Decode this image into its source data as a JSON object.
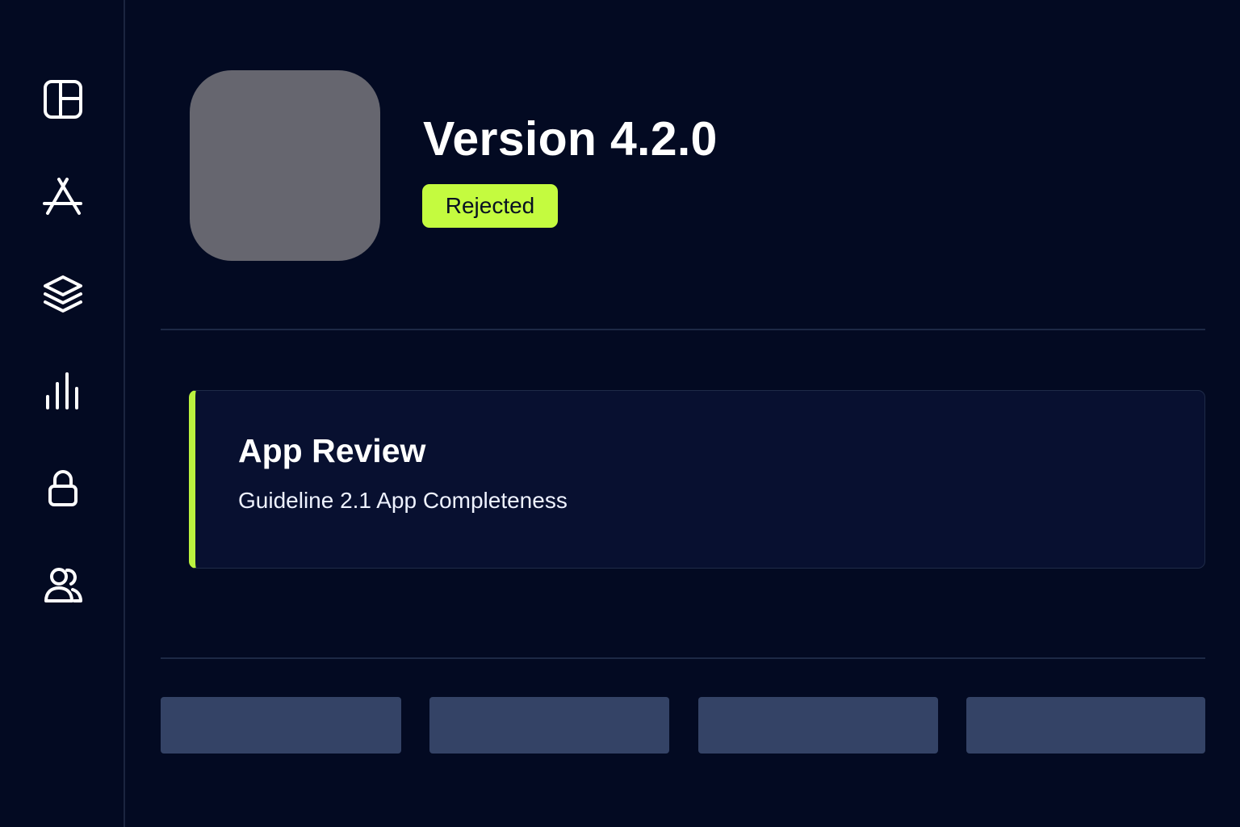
{
  "sidebar": {
    "items": [
      {
        "id": "dashboard",
        "icon": "dashboard-layout-icon"
      },
      {
        "id": "app-store",
        "icon": "app-store-icon"
      },
      {
        "id": "layers",
        "icon": "layers-icon"
      },
      {
        "id": "analytics",
        "icon": "bar-chart-icon"
      },
      {
        "id": "security",
        "icon": "lock-icon"
      },
      {
        "id": "users",
        "icon": "users-icon"
      }
    ]
  },
  "header": {
    "version_title": "Version 4.2.0",
    "status": "Rejected",
    "status_color": "#c4fb3f"
  },
  "review": {
    "title": "App Review",
    "guideline": "Guideline 2.1 App Completeness",
    "accent_color": "#bbf23f"
  },
  "theme": {
    "background": "#030a22",
    "card_background": "#081030",
    "button_color": "#344366",
    "app_icon_placeholder": "#66666f"
  }
}
